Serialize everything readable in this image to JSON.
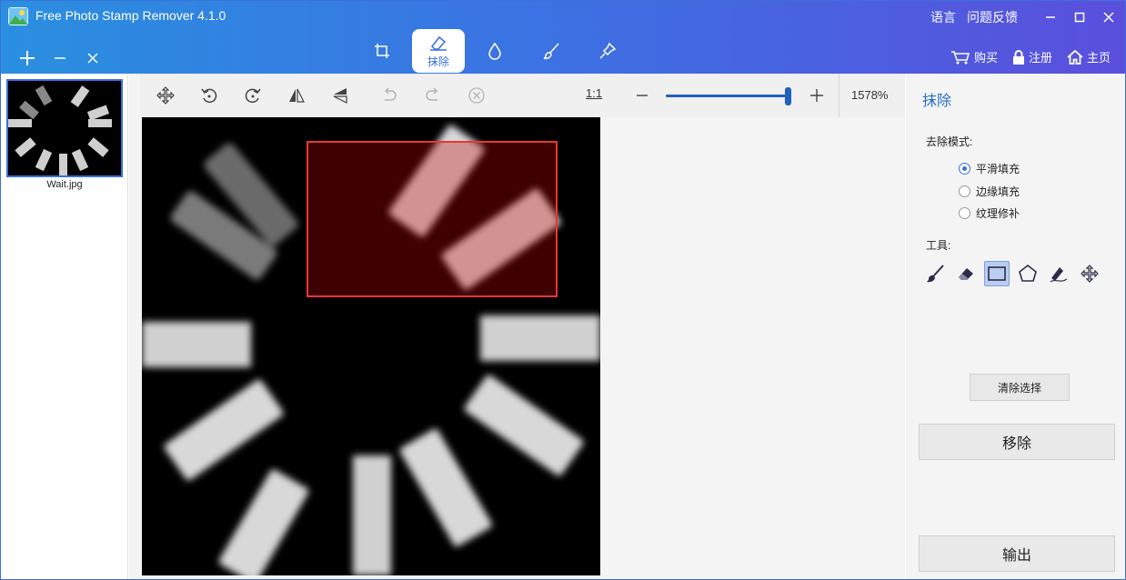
{
  "app": {
    "title": "Free Photo Stamp Remover 4.1.0"
  },
  "top_links": {
    "language": "语言",
    "feedback": "问题反馈"
  },
  "mode_tabs": {
    "erase_label": "抹除"
  },
  "top_actions": {
    "buy": "购买",
    "register": "注册",
    "home": "主页"
  },
  "thumbnails": [
    {
      "name": "Wait.jpg"
    }
  ],
  "toolbar": {
    "ratio_label": "1:1",
    "zoom_value": "1578%",
    "zoom_level_fraction": 0.97
  },
  "right_panel": {
    "title": "抹除",
    "mode_label": "去除模式:",
    "modes": [
      {
        "label": "平滑填充",
        "selected": true
      },
      {
        "label": "边缘填充",
        "selected": false
      },
      {
        "label": "纹理修补",
        "selected": false
      }
    ],
    "tools_label": "工具:",
    "tools": [
      "brush-icon",
      "eraser-icon",
      "rectangle-select-icon",
      "polygon-select-icon",
      "magic-pen-icon",
      "move-icon"
    ],
    "clear_selection": "清除选择",
    "remove": "移除",
    "export": "输出"
  },
  "colors": {
    "accent": "#3a6fe0",
    "selection": "#e53935",
    "title_gradient_start": "#2a8fe0",
    "title_gradient_end": "#5a4fdd"
  }
}
